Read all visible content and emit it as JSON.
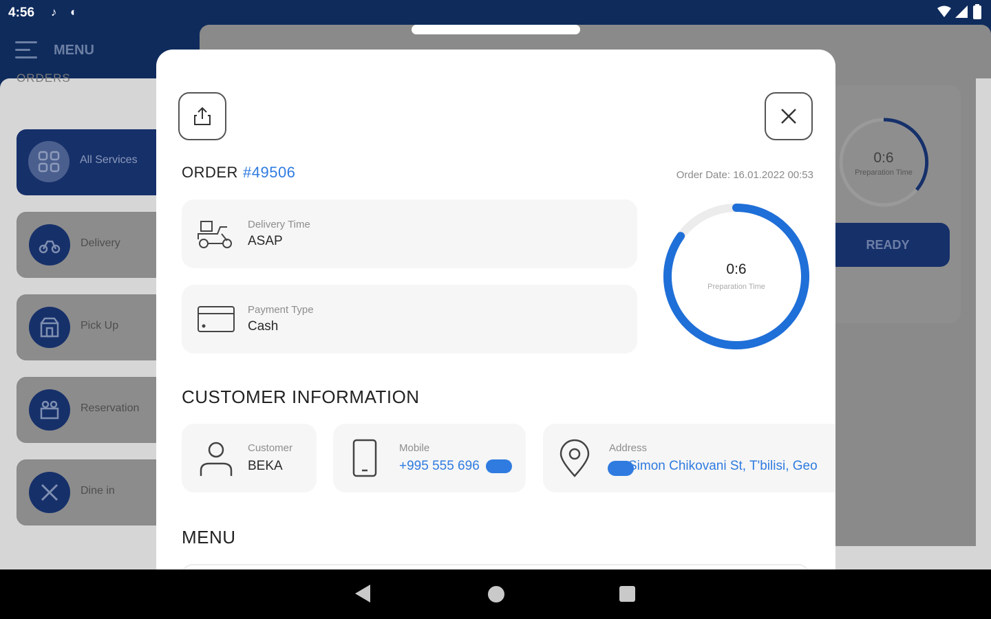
{
  "status_bar": {
    "time": "4:56"
  },
  "background": {
    "menu_label": "MENU",
    "orders_title": "ORDERS",
    "sidebar": [
      {
        "label": "All Services",
        "icon": "grid-icon",
        "active": true
      },
      {
        "label": "Delivery",
        "icon": "delivery-bike-icon",
        "active": false
      },
      {
        "label": "Pick Up",
        "icon": "pickup-store-icon",
        "active": false
      },
      {
        "label": "Reservation",
        "icon": "reservation-icon",
        "active": false
      },
      {
        "label": "Dine in",
        "icon": "utensils-icon",
        "active": false
      }
    ],
    "timer": {
      "value": "0:6",
      "label": "Preparation Time"
    },
    "ready_button": "READY"
  },
  "modal": {
    "order_label": "ORDER",
    "order_number": "#49506",
    "order_date": "Order Date: 16.01.2022 00:53",
    "delivery": {
      "label": "Delivery Time",
      "value": "ASAP"
    },
    "payment": {
      "label": "Payment Type",
      "value": "Cash"
    },
    "timer": {
      "value": "0:6",
      "label": "Preparation Time",
      "progress": 0.85
    },
    "customer_section_title": "CUSTOMER INFORMATION",
    "customer": {
      "label": "Customer",
      "value": "BEKA"
    },
    "mobile": {
      "label": "Mobile",
      "value": "+995 555 696"
    },
    "address": {
      "label": "Address",
      "value": "Simon Chikovani St, T'bilisi, Geo"
    },
    "menu_section_title": "MENU"
  },
  "colors": {
    "primary": "#16306a",
    "accent": "#2f7be0",
    "status_bar": "#0f2b5c"
  }
}
